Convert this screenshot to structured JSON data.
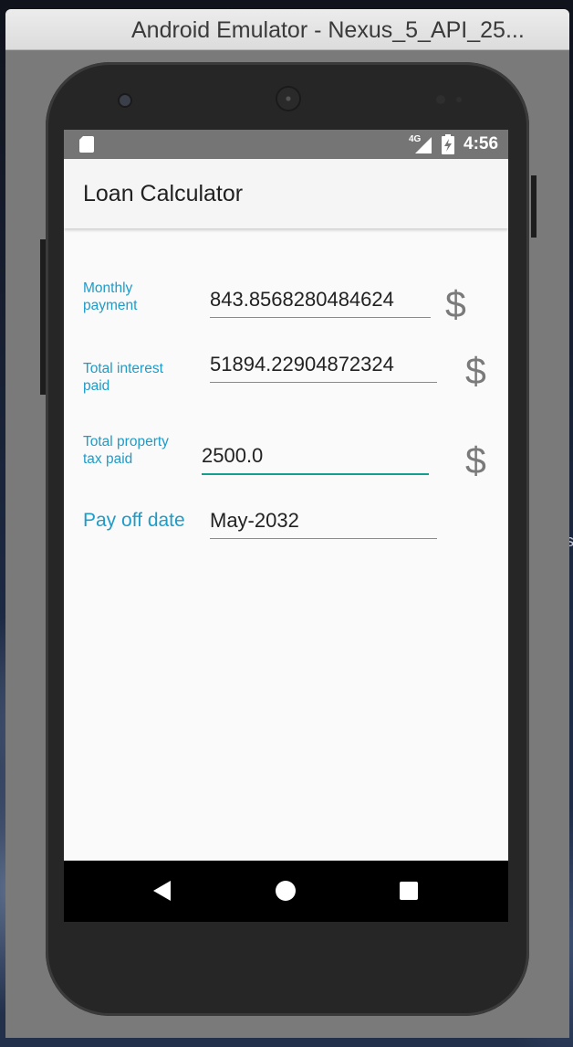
{
  "window": {
    "title": "Android Emulator - Nexus_5_API_25..."
  },
  "desktop": {
    "edge_text": "s"
  },
  "status_bar": {
    "network_label": "4G",
    "time": "4:56"
  },
  "app": {
    "title": "Loan Calculator"
  },
  "results": {
    "monthly_payment": {
      "label": "Monthly payment",
      "value": "843.8568280484624",
      "unit": "$"
    },
    "total_interest": {
      "label": "Total interest paid",
      "value": "51894.22904872324",
      "unit": "$"
    },
    "total_property_tax": {
      "label": "Total property tax paid",
      "value": "2500.0",
      "unit": "$"
    },
    "pay_off_date": {
      "label": "Pay off date",
      "value": "May-2032"
    }
  },
  "colors": {
    "accent": "#1e9cc9",
    "focus_underline": "#149e8e",
    "status_bar": "#757575"
  },
  "icons": [
    "sd-card-icon",
    "signal-icon",
    "battery-charging-icon",
    "back-icon",
    "home-icon",
    "recents-icon"
  ]
}
